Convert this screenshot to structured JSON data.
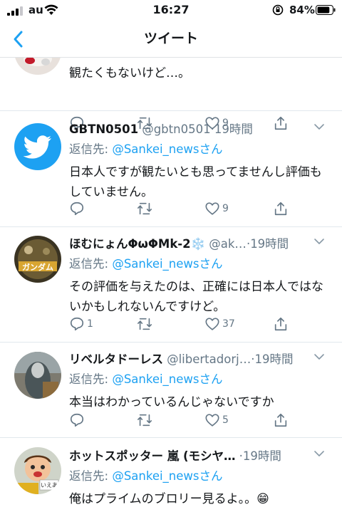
{
  "status_bar": {
    "carrier": "au",
    "time": "16:27",
    "battery_percent": "84%",
    "battery_level": 0.84
  },
  "nav": {
    "title": "ツイート"
  },
  "tweets": [
    {
      "display_name": "",
      "handle": "",
      "time": "",
      "reply_to_prefix": "",
      "reply_to_user": "",
      "reply_to_suffix": "",
      "text": "観たくもないけど…。",
      "replies": "",
      "likes": "9"
    },
    {
      "display_name": "GBTN0501",
      "handle": "@gbtn0501",
      "dot": "·",
      "time": "19時間",
      "reply_to_prefix": "返信先: ",
      "reply_to_user": "@Sankei_news",
      "reply_to_suffix": "さん",
      "text": "日本人ですが観たいとも思ってませんし評価もしていません。",
      "replies": "",
      "likes": "9"
    },
    {
      "display_name": "ほむにょんΦωΦMk-2❄️",
      "handle": "@ak…",
      "dot": "·",
      "time": "19時間",
      "reply_to_prefix": "返信先: ",
      "reply_to_user": "@Sankei_news",
      "reply_to_suffix": "さん",
      "text": "その評価を与えたのは、正確には日本人ではないかもしれないんですけど。",
      "replies": "1",
      "likes": "37",
      "avatar_caption": "ガンダム"
    },
    {
      "display_name": "リベルタドーレス",
      "handle": "@libertadorj…",
      "dot": "·",
      "time": "19時間",
      "reply_to_prefix": "返信先: ",
      "reply_to_user": "@Sankei_news",
      "reply_to_suffix": "さん",
      "text": "本当はわかっているんじゃないですか",
      "replies": "",
      "likes": "5"
    },
    {
      "display_name": "ホットスポッター 嵐 (モシヤ…",
      "handle": "",
      "dot": "·",
      "time": "19時間",
      "reply_to_prefix": "返信先: ",
      "reply_to_user": "@Sankei_news",
      "reply_to_suffix": "さん",
      "text": "俺はプライムのブロリー見るよ。。😁",
      "replies": "",
      "likes": "",
      "avatar_caption": "いえあ"
    }
  ],
  "icons": {
    "reply": "reply-icon",
    "retweet": "retweet-icon",
    "like": "heart-icon",
    "share": "share-icon",
    "back": "chevron-left-icon",
    "menu": "chevron-down-icon"
  },
  "colors": {
    "accent": "#1da1f2",
    "secondary_text": "#657786",
    "primary_text": "#14171a",
    "divider": "#e1e8ed"
  }
}
